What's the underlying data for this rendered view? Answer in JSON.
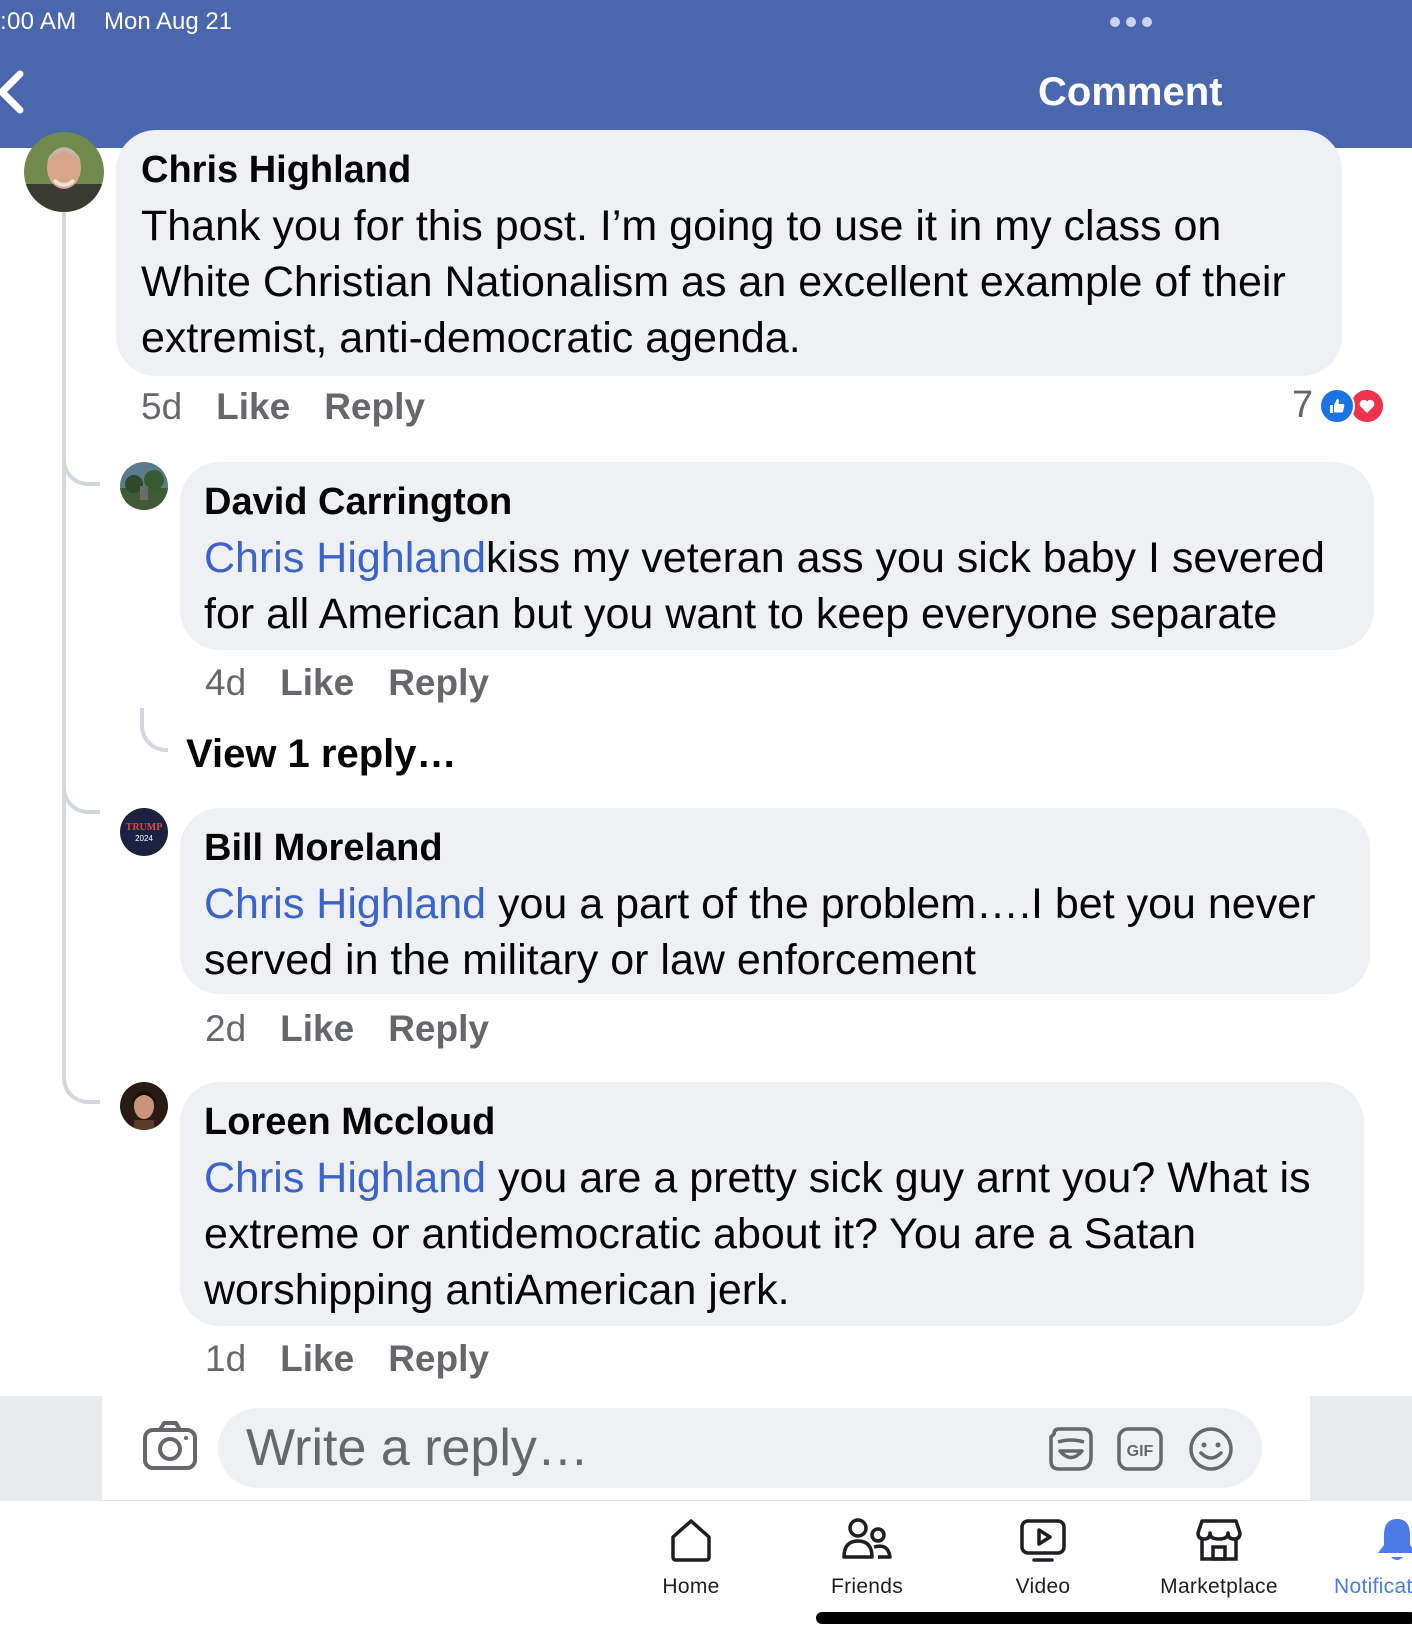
{
  "status_bar": {
    "time": ":00 AM",
    "date": "Mon Aug 21"
  },
  "header": {
    "title": "Comment",
    "back_icon": "chevron-left-icon",
    "more_icon": "more-dots-icon"
  },
  "main_comment": {
    "author": "Chris Highland",
    "text": "Thank you for this post.  I’m going to use it in my class on White Christian Nationalism as an excellent example of their extremist, anti-democratic agenda.",
    "time": "5d",
    "like_label": "Like",
    "reply_label": "Reply",
    "reaction_count": "7",
    "reactions": [
      "like-reaction-icon",
      "love-reaction-icon"
    ]
  },
  "replies": [
    {
      "author": "David Carrington",
      "mention": "Chris Highland",
      "text": "kiss my veteran ass you sick baby I severed for all American but you want to keep everyone separate",
      "time": "4d",
      "like_label": "Like",
      "reply_label": "Reply"
    },
    {
      "author": "Bill Moreland",
      "mention": "Chris Highland",
      "text": " you a part of the problem….I  bet you never served in the military or law enforcement",
      "time": "2d",
      "like_label": "Like",
      "reply_label": "Reply"
    },
    {
      "author": "Loreen Mccloud",
      "mention": "Chris Highland",
      "text": " you are a pretty sick guy arnt you? What is extreme or antidemocratic about it? You are a Satan worshipping antiAmerican jerk.",
      "time": "1d",
      "like_label": "Like",
      "reply_label": "Reply"
    }
  ],
  "view_replies": "View 1 reply…",
  "avatar_badge": {
    "line1": "TRUMP",
    "line2": "2024"
  },
  "reply_box": {
    "placeholder": "Write a reply…",
    "gif_label": "GIF"
  },
  "tabbar": [
    {
      "label": "Home",
      "icon": "home-icon"
    },
    {
      "label": "Friends",
      "icon": "friends-icon"
    },
    {
      "label": "Video",
      "icon": "video-icon"
    },
    {
      "label": "Marketplace",
      "icon": "marketplace-icon"
    },
    {
      "label": "Notificat",
      "icon": "bell-icon",
      "active": true
    }
  ],
  "colors": {
    "header": "#4a67ad",
    "mention": "#3b63cc",
    "active_tab": "#4b7be5",
    "bubble": "#eff0f3"
  }
}
